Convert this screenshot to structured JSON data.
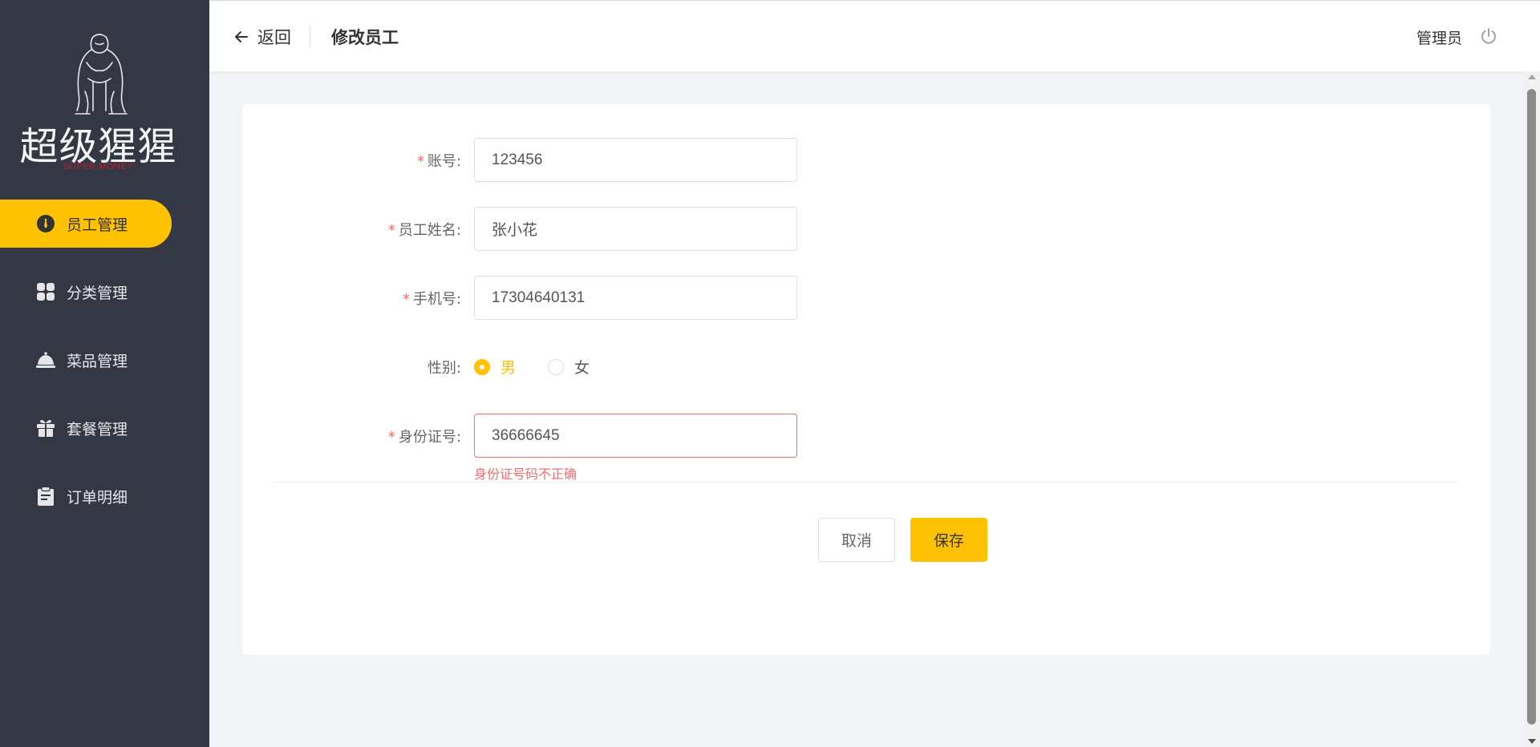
{
  "sidebar": {
    "logo": {
      "title": "超级猩猩",
      "subtitle": "SUPER MONEY"
    },
    "items": [
      {
        "label": "员工管理",
        "icon": "employee-icon",
        "active": true
      },
      {
        "label": "分类管理",
        "icon": "category-grid-icon",
        "active": false
      },
      {
        "label": "菜品管理",
        "icon": "dish-cloche-icon",
        "active": false
      },
      {
        "label": "套餐管理",
        "icon": "gift-package-icon",
        "active": false
      },
      {
        "label": "订单明细",
        "icon": "clipboard-order-icon",
        "active": false
      }
    ]
  },
  "header": {
    "back_label": "返回",
    "title": "修改员工",
    "user": "管理员"
  },
  "form": {
    "account": {
      "label": "账号:",
      "value": "123456",
      "required": true
    },
    "name": {
      "label": "员工姓名:",
      "value": "张小花",
      "required": true
    },
    "phone": {
      "label": "手机号:",
      "value": "17304640131",
      "required": true
    },
    "gender": {
      "label": "性别:",
      "options": [
        "男",
        "女"
      ],
      "selected": "男"
    },
    "id_number": {
      "label": "身份证号:",
      "value": "36666645",
      "required": true,
      "error": "身份证号码不正确"
    },
    "required_mark": "*"
  },
  "actions": {
    "cancel": "取消",
    "save": "保存"
  },
  "colors": {
    "accent": "#ffc200",
    "sidebar_bg": "#343744",
    "error": "#f56c6c"
  }
}
